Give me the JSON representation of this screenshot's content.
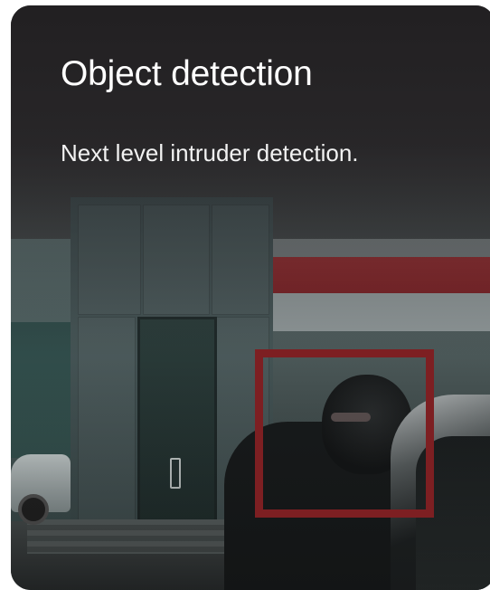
{
  "card": {
    "title": "Object detection",
    "subtitle": "Next level intruder detection."
  },
  "detection": {
    "box_color": "#7d1f22"
  },
  "colors": {
    "card_background": "#2f3434",
    "title_text": "#ffffff",
    "subtitle_text": "#f2f2f2"
  }
}
